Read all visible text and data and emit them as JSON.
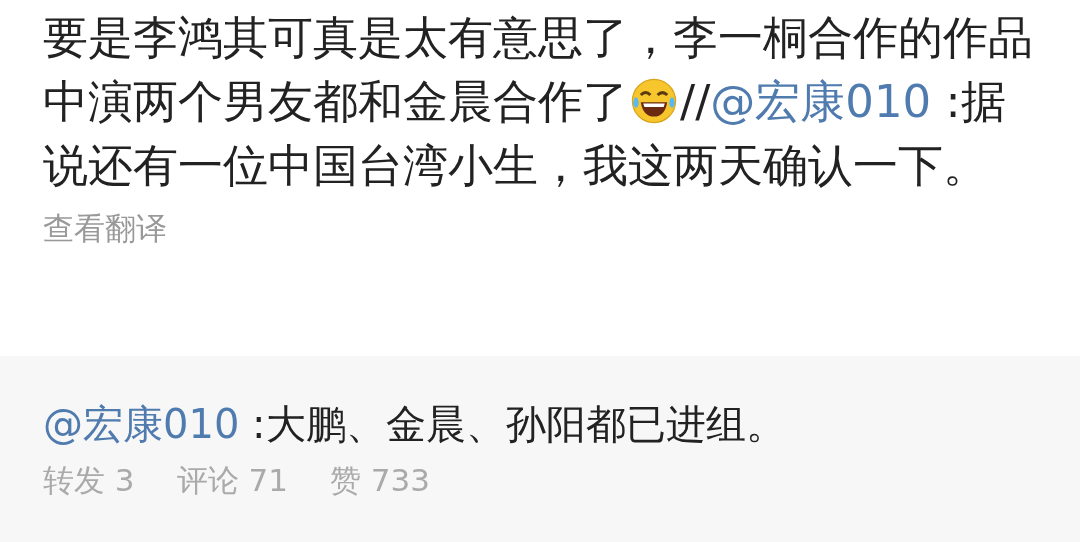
{
  "post": {
    "segments": [
      {
        "kind": "text",
        "text": "要是李鸿其可真是太有意思了，李一桐合作的作品中演两个男友都和金晨合作了"
      },
      {
        "kind": "emoji"
      },
      {
        "kind": "text",
        "text": "//"
      },
      {
        "kind": "mention",
        "text": "@宏康010"
      },
      {
        "kind": "text",
        "text": " :据说还有一位中国台湾小生，我这两天确认一下。"
      }
    ],
    "translate_link": "查看翻译"
  },
  "retweet": {
    "mention": "@宏康010",
    "text": " :大鹏、金晨、孙阳都已进组。",
    "stats": [
      {
        "label": "转发 3"
      },
      {
        "label": "评论 71"
      },
      {
        "label": "赞 733"
      }
    ]
  }
}
